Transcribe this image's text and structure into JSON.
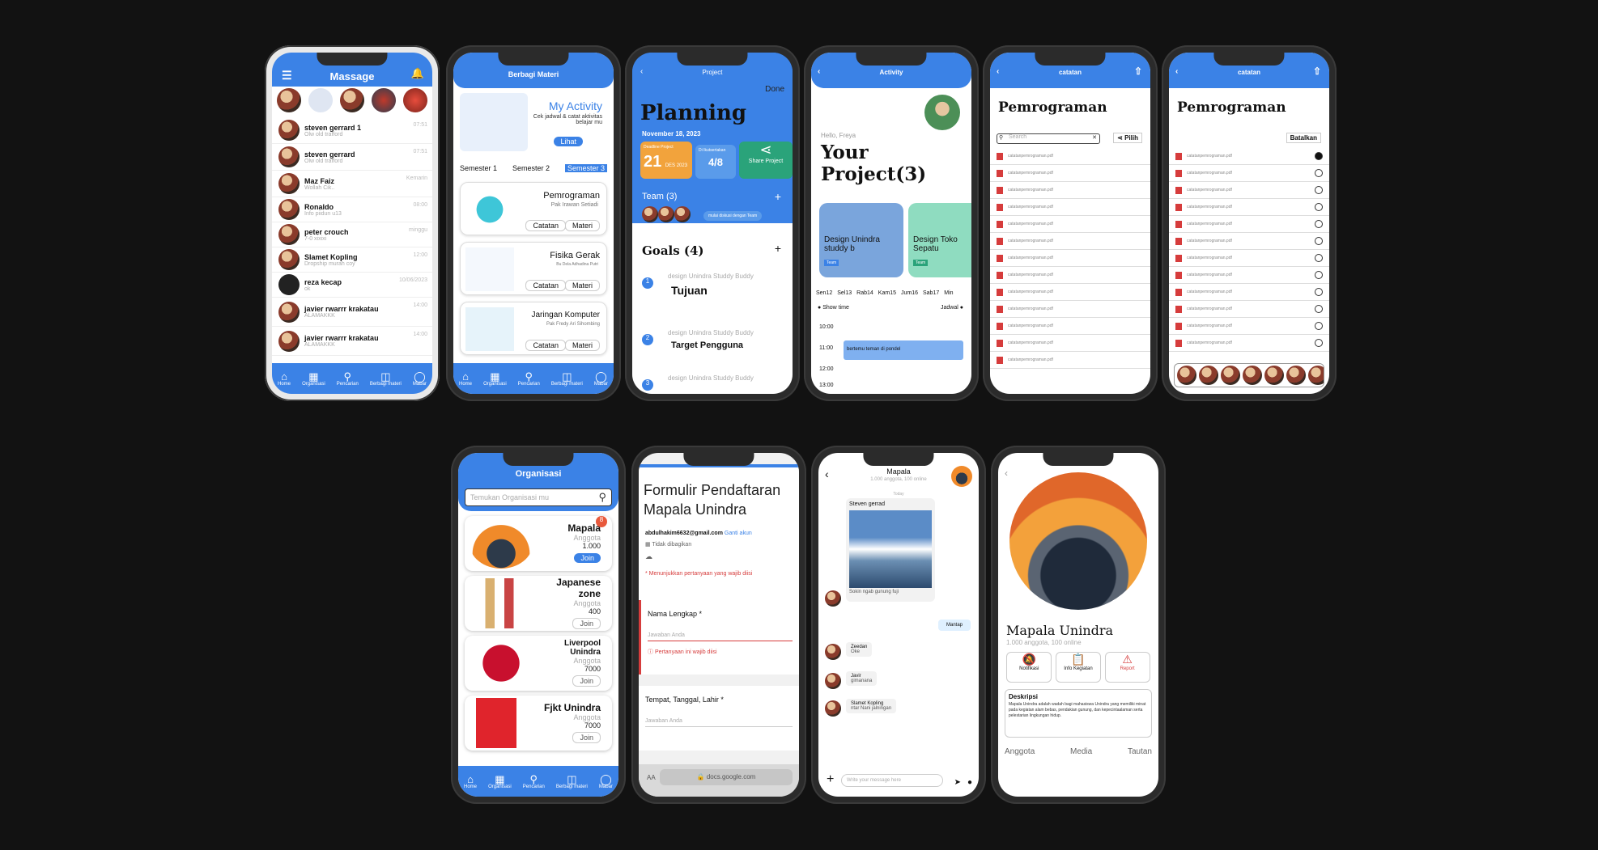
{
  "colors": {
    "primary": "#3b82e6",
    "background": "#121212",
    "green": "#2aa37a",
    "red": "#d63c3c"
  },
  "nav": [
    {
      "icon": "home-icon",
      "label": "Home"
    },
    {
      "icon": "organisasi-icon",
      "label": "Organisasi"
    },
    {
      "icon": "search-icon",
      "label": "Pencarian"
    },
    {
      "icon": "book-icon",
      "label": "Berbagi materi"
    },
    {
      "icon": "gamepad-icon",
      "label": "Mabar"
    }
  ],
  "s1": {
    "title": "Massage",
    "chats": [
      {
        "name": "steven gerrard 1",
        "msg": "Olw old trafford",
        "time": "07:51"
      },
      {
        "name": "steven gerrard",
        "msg": "Olw old trafford",
        "time": "07:51"
      },
      {
        "name": "Maz Faiz",
        "msg": "Wollah Cik..",
        "time": "Kemarin"
      },
      {
        "name": "Ronaldo",
        "msg": "Info piidun u13",
        "time": "08:00"
      },
      {
        "name": "peter crouch",
        "msg": "7-0 xixixi",
        "time": "minggu"
      },
      {
        "name": "Slamet Kopling",
        "msg": "Dropship murah coy",
        "time": "12:00"
      },
      {
        "name": "reza kecap",
        "msg": "ok",
        "time": "10/06/2023"
      },
      {
        "name": "javier rwarrr krakatau",
        "msg": "ALAMAKKK",
        "time": "14:00"
      },
      {
        "name": "javier rwarrr krakatau",
        "msg": "ALAMAKKK",
        "time": "14:00"
      }
    ]
  },
  "s2": {
    "title": "Berbagi Materi",
    "activity_title": "My Activity",
    "activity_sub": "Cek jadwal & catat aktivitas belajar mu",
    "activity_btn": "Lihat",
    "semesters": [
      "Semester 1",
      "Semester 2",
      "Semester 3"
    ],
    "courses": [
      {
        "name": "Pemrograman",
        "lecturer": "Pak Irawan Setiadi"
      },
      {
        "name": "Fisika Gerak",
        "lecturer": "Bu Dela Adhadina Putri"
      },
      {
        "name": "Jaringan Komputer",
        "lecturer": "Pak Fredy Ari Sihombing"
      }
    ],
    "catatan": "Catatan",
    "materi": "Materi"
  },
  "s3": {
    "header": "Project",
    "done": "Done",
    "title": "Planning",
    "date": "November 18, 2023",
    "deadline_label": "Deadline Project",
    "deadline_value": "21",
    "deadline_month": "DES 2023",
    "anggota_label": "Di Ikutsertakan",
    "anggota_value": "4/8",
    "share": "Share Project",
    "team": "Team (3)",
    "team_msg": "mulai diskusi dengan Team",
    "goals": "Goals (4)",
    "goal_items": [
      {
        "num": "1",
        "project": "design Unindra Studdy Buddy",
        "title": "Tujuan"
      },
      {
        "num": "2",
        "project": "design Unindra Studdy Buddy",
        "title": "Target Pengguna"
      },
      {
        "num": "3",
        "project": "design Unindra Studdy Buddy",
        "title": ""
      }
    ]
  },
  "s4": {
    "header": "Activity",
    "hello": "Hello, Freya",
    "title": "Your Project(3)",
    "cards": [
      {
        "title": "Design Unindra studdy b",
        "team": "Team"
      },
      {
        "title": "Design Toko Sepatu",
        "team": "Team"
      }
    ],
    "days": [
      "Sen12",
      "Sel13",
      "Rab14",
      "Kam15",
      "Jum16",
      "Sab17",
      "Min"
    ],
    "show_time": "Show time",
    "jadwal": "Jadwal",
    "times": [
      "10:00",
      "11:00",
      "12:00",
      "13:00"
    ],
    "event": "bertemu teman di pondel"
  },
  "s5": {
    "header": "catatan",
    "title": "Pemrograman",
    "search": "Search",
    "pilih": "Pilih",
    "file": "catatanpemrograman.pdf"
  },
  "s6": {
    "header": "catatan",
    "title": "Pemrograman",
    "batalkan": "Batalkan",
    "file": "catatanpemrograman.pdf"
  },
  "s7": {
    "title": "Organisasi",
    "search": "Temukan Organisasi mu",
    "anggota": "Anggota",
    "join": "Join",
    "orgs": [
      {
        "name": "Mapala",
        "count": "1.000",
        "badge": "8"
      },
      {
        "name": "Japanese zone",
        "count": "400"
      },
      {
        "name": "Liverpool Unindra",
        "count": "7000"
      },
      {
        "name": "Fjkt Unindra",
        "count": "7000"
      }
    ]
  },
  "s8": {
    "title": "Formulir Pendaftaran Mapala Unindra",
    "email": "abdulhakim6632@gmail.com",
    "switch": "Ganti akun",
    "not_shared": "Tidak dibagikan",
    "required": "* Menunjukkan pertanyaan yang wajib diisi",
    "q1": "Nama Lengkap *",
    "answer": "Jawaban Anda",
    "error": "Pertanyaan ini wajib diisi",
    "q2": "Tempat, Tanggal, Lahir *",
    "aa": "AA",
    "url": "docs.google.com"
  },
  "s9": {
    "title": "Mapala",
    "sub": "1.000 anggota, 100 online",
    "day": "Today",
    "messages": [
      {
        "name": "Steven gerrad",
        "text": "Sokin ngab gunung fuji"
      },
      {
        "mine": true,
        "text": "Mantap"
      },
      {
        "name": "Zeedan",
        "text": "Oke"
      },
      {
        "name": "Javir",
        "text": "gimanana"
      },
      {
        "name": "Slamet Kopling",
        "text": "ntar Nani jalningan"
      }
    ],
    "input": "Write your message here"
  },
  "s10": {
    "name": "Mapala Unindra",
    "sub": "1.000 anggota, 100 online",
    "actions": [
      {
        "icon": "bell-off-icon",
        "label": "Notifikasi"
      },
      {
        "icon": "clipboard-icon",
        "label": "Info Kegiatan"
      },
      {
        "icon": "warning-icon",
        "label": "Report"
      }
    ],
    "desc_title": "Deskripsi",
    "desc": "Mapala Unindra adalah wadah bagi mahasiswa Unindra yang memiliki minat pada kegiatan alam bebas, pendakian gunung, dan kepecintaalaman serta pelestarian lingkungan hidup.",
    "tabs": [
      "Anggota",
      "Media",
      "Tautan"
    ]
  }
}
